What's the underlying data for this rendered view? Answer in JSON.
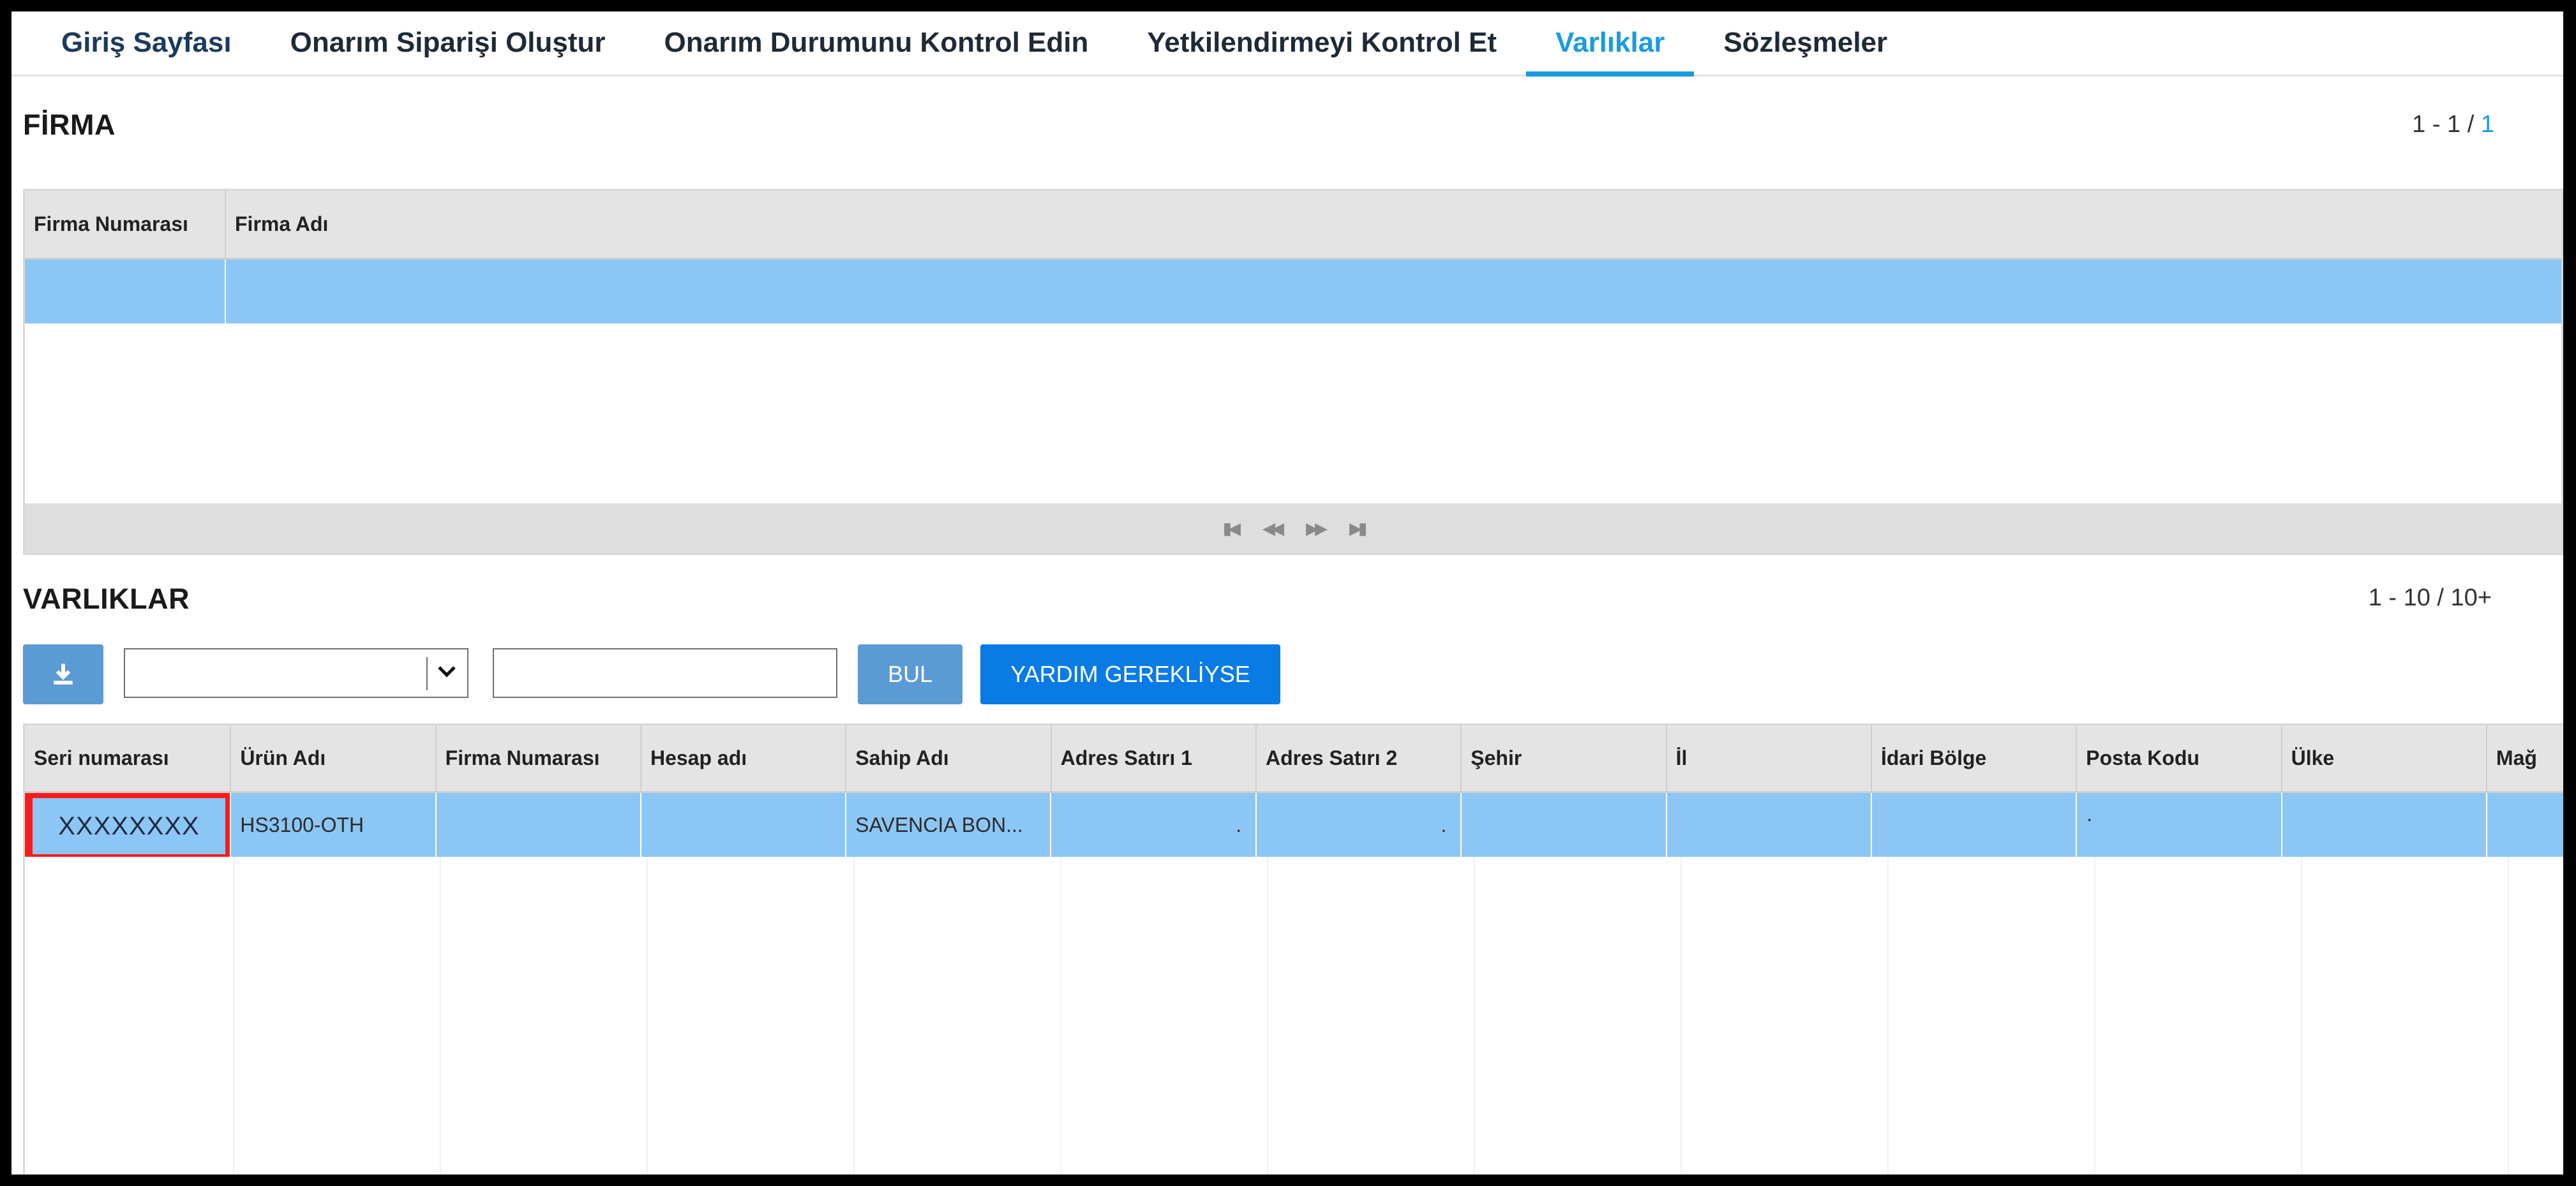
{
  "nav": {
    "items": [
      {
        "label": "Giriş Sayfası",
        "active": false
      },
      {
        "label": "Onarım Siparişi Oluştur",
        "active": false
      },
      {
        "label": "Onarım Durumunu Kontrol Edin",
        "active": false
      },
      {
        "label": "Yetkilendirmeyi Kontrol Et",
        "active": false
      },
      {
        "label": "Varlıklar",
        "active": true
      },
      {
        "label": "Sözleşmeler",
        "active": false
      }
    ]
  },
  "firma": {
    "title": "FİRMA",
    "pager_prefix": "1 - 1 / ",
    "pager_total": "1",
    "columns": [
      "Firma Numarası",
      "Firma Adı"
    ],
    "rows": [
      [
        "",
        ""
      ]
    ]
  },
  "varliklar": {
    "title": "VARLIKLAR",
    "pager": "1 - 10 / 10+",
    "search_value": "",
    "select_value": "",
    "find_label": "BUL",
    "help_label": "YARDIM GEREKLİYSE",
    "columns": [
      "Seri numarası",
      "Ürün Adı",
      "Firma Numarası",
      "Hesap adı",
      "Sahip Adı",
      "Adres Satırı 1",
      "Adres Satırı 2",
      "Şehir",
      "İl",
      "İdari Bölge",
      "Posta Kodu",
      "Ülke",
      "Mağ"
    ],
    "rows": [
      [
        "XXXXXXXX",
        "HS3100-OTH",
        "",
        "",
        "SAVENCIA BON...",
        ".",
        ".",
        "",
        "",
        "",
        "·",
        "",
        ""
      ]
    ]
  },
  "colors": {
    "accent": "#1a9be0",
    "row_selected": "#8cc6f4",
    "button_blue": "#5b9bd5",
    "button_primary": "#0a7be5",
    "highlight": "#ff1a1a"
  }
}
